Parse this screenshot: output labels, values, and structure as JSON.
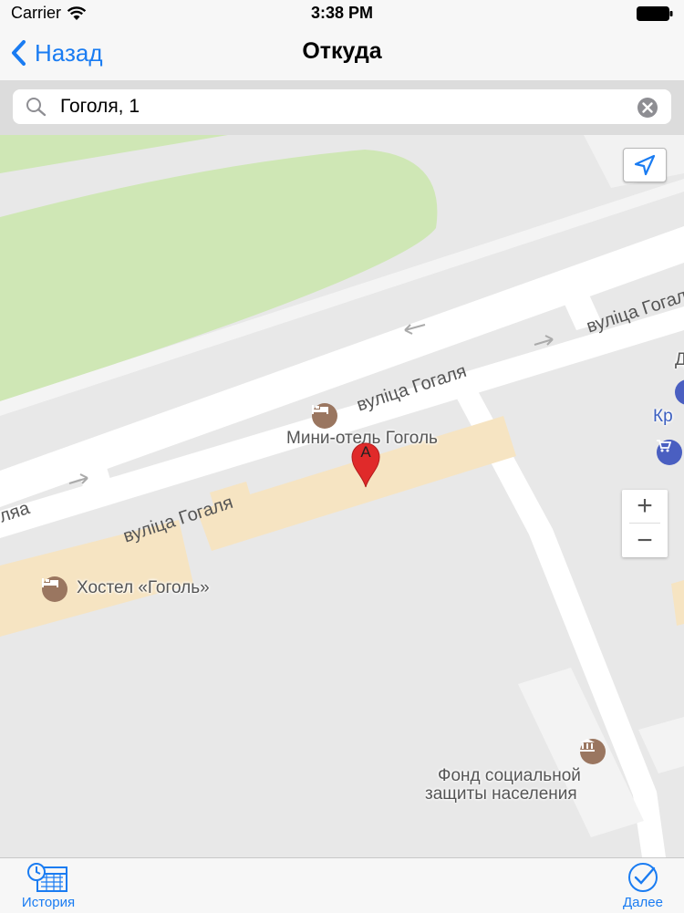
{
  "status_bar": {
    "carrier": "Carrier",
    "time": "3:38 PM"
  },
  "nav": {
    "back_label": "Назад",
    "title": "Откуда"
  },
  "search": {
    "value": "Гоголя, 1"
  },
  "map": {
    "street_labels": [
      "вуліца Гогаля",
      "вуліца Гогаля",
      "вуліца Гогаля",
      "ляа"
    ],
    "places": {
      "mini_hotel": "Мини-отель Гоголь",
      "hostel": "Хостел «Гоголь»",
      "fund_line1": "Фонд социальной",
      "fund_line2": "защиты населения",
      "edge_kr": "Кр",
      "edge_d": "Д"
    },
    "marker_label": "A",
    "zoom_in": "+",
    "zoom_out": "−"
  },
  "tabs": {
    "history_label": "История",
    "next_label": "Далее"
  },
  "colors": {
    "accent": "#1a7cf2",
    "park": "#cfe7b5",
    "road": "#ffffff",
    "building": "#f6e4c2",
    "pin": "#e02a2a"
  }
}
